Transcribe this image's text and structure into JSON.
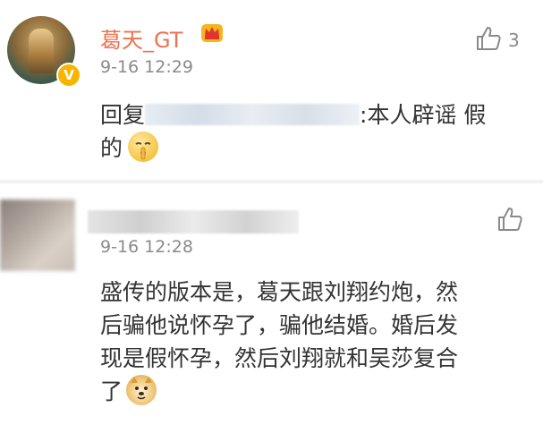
{
  "comment1": {
    "username": "葛天_GT",
    "timestamp": "9-16 12:29",
    "like_count": "3",
    "reply_prefix": "回复",
    "reply_suffix": ":本人辟谣 假",
    "text_line2": "的",
    "icons": [
      "crown-vip-icon",
      "verified-v-icon",
      "thumbs-up-icon",
      "shush-emoji"
    ]
  },
  "comment2": {
    "timestamp": "9-16 12:28",
    "lines": [
      "盛传的版本是，葛天跟刘翔约炮，然",
      "后骗他说怀孕了，骗他结婚。婚后发",
      "现是假怀孕，然后刘翔就和吴莎复合",
      "了"
    ],
    "icons": [
      "thumbs-up-icon",
      "doge-emoji"
    ]
  },
  "colors": {
    "username": "#eb7350",
    "meta": "#8a8a8a",
    "text": "#333333",
    "verified": "#f7b500"
  }
}
